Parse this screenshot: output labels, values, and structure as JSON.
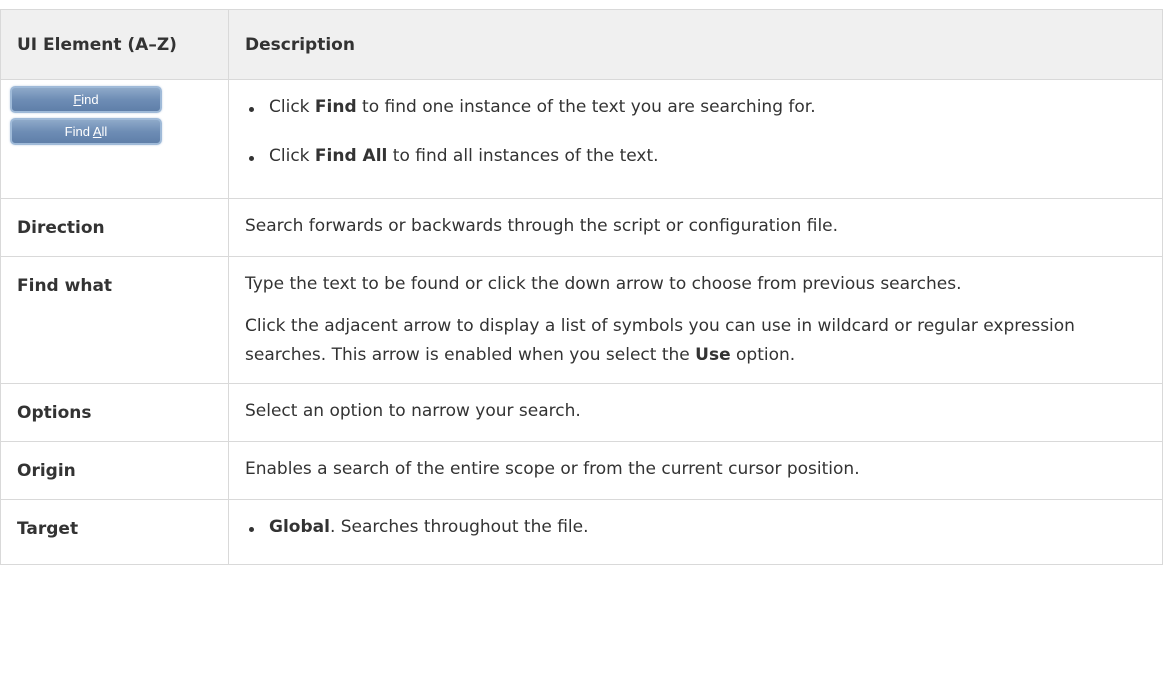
{
  "table": {
    "headers": {
      "element": "UI Element (A–Z)",
      "description": "Description"
    },
    "buttons_row": {
      "find_button": {
        "pre": "",
        "accel": "F",
        "post": "ind"
      },
      "find_all_button": {
        "pre": "Find ",
        "accel": "A",
        "post": "ll"
      },
      "bullets": [
        {
          "pre": "Click ",
          "bold": "Find",
          "post": " to find one instance of the text you are searching for."
        },
        {
          "pre": "Click ",
          "bold": "Find All",
          "post": " to find all instances of the text."
        }
      ]
    },
    "rows": {
      "direction": {
        "element": "Direction",
        "description": "Search forwards or backwards through the script or configuration file."
      },
      "find_what": {
        "element": "Find what",
        "p1": "Type the text to be found or click the down arrow to choose from previous searches.",
        "p2_pre": "Click the adjacent arrow to display a list of symbols you can use in wildcard or regular expression searches. This arrow is enabled when you select the ",
        "p2_bold": "Use",
        "p2_post": " option."
      },
      "options": {
        "element": "Options",
        "description": "Select an option to narrow your search."
      },
      "origin": {
        "element": "Origin",
        "description": "Enables a search of the entire scope or from the current cursor position."
      },
      "target": {
        "element": "Target",
        "bullet_bold": "Global",
        "bullet_post": ". Searches throughout the file."
      }
    }
  }
}
